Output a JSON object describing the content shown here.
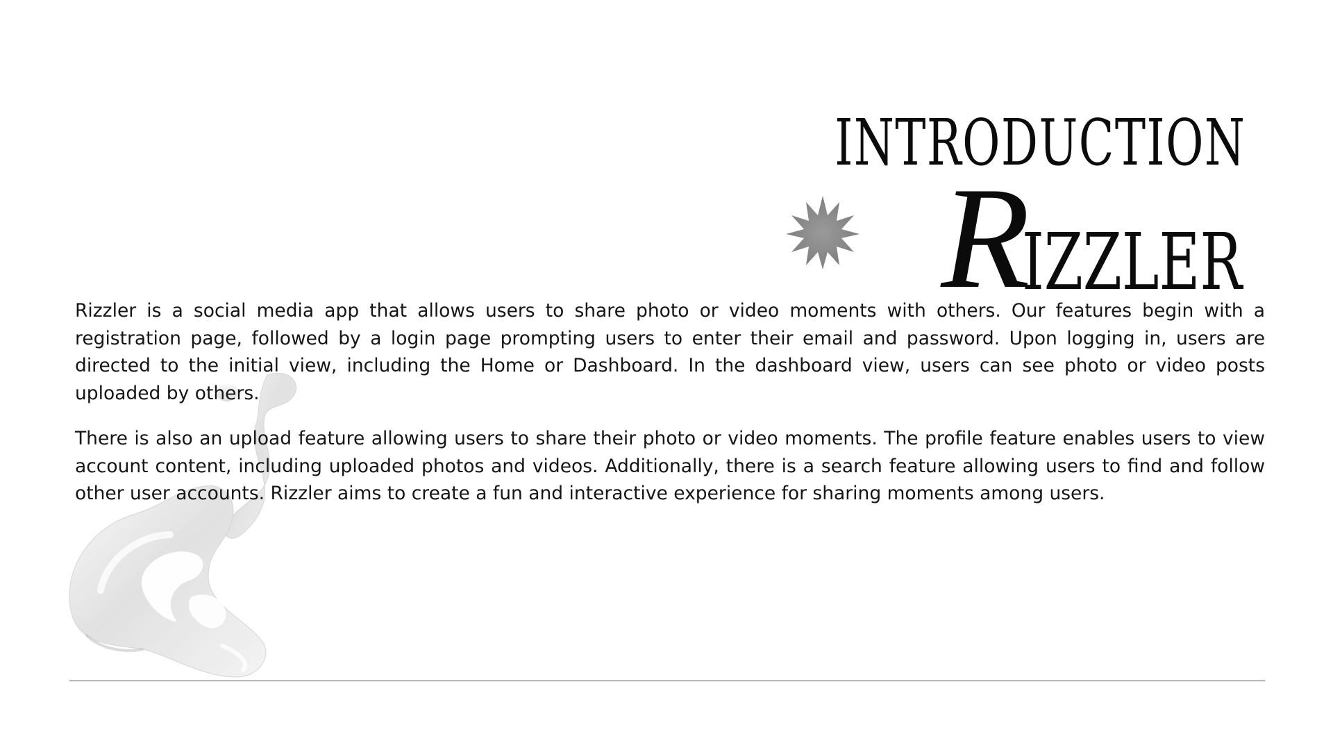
{
  "header": {
    "title_line1": "INTRODUCTION",
    "title_initial": "R",
    "title_rest": "IZZLER"
  },
  "body": {
    "paragraph1": "Rizzler is a social media app that allows users to share photo or video moments with others. Our features begin with a registration page, followed by a login page prompting users to enter their email and password. Upon logging in, users are directed to the initial view, including the Home or Dashboard. In the dashboard view, users can see photo or video posts uploaded by others.",
    "paragraph2": "There is also an upload feature allowing users to share their photo or video moments. The profile feature enables users to view account content, including uploaded photos and videos. Additionally, there is a search feature allowing users to find and follow other user accounts. Rizzler aims to create a fun and interactive experience for sharing moments among users."
  },
  "decor": {
    "star_color": "#8a8a8a",
    "blob_color": "#e8e8e8",
    "divider_color": "#555555",
    "star_icon": "star-burst-icon",
    "blob_icon": "chrome-blob-icon"
  }
}
